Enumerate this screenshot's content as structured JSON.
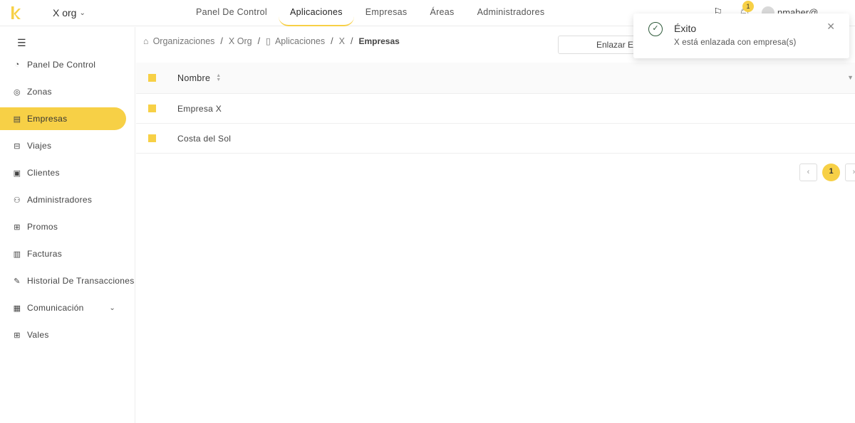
{
  "header": {
    "org_name": "X org",
    "nav": [
      "Panel De Control",
      "Aplicaciones",
      "Empresas",
      "Áreas",
      "Administradores"
    ],
    "active_nav": "Aplicaciones",
    "notification_count": "1",
    "username": "nmaher@"
  },
  "sidebar": {
    "items": [
      {
        "label": "Panel De Control",
        "icon": "pie-chart-icon"
      },
      {
        "label": "Zonas",
        "icon": "location-pin-icon"
      },
      {
        "label": "Empresas",
        "icon": "building-icon"
      },
      {
        "label": "Viajes",
        "icon": "car-icon"
      },
      {
        "label": "Clientes",
        "icon": "id-card-icon"
      },
      {
        "label": "Administradores",
        "icon": "users-icon"
      },
      {
        "label": "Promos",
        "icon": "gift-icon"
      },
      {
        "label": "Facturas",
        "icon": "invoice-icon"
      },
      {
        "label": "Historial De Transacciones",
        "icon": "edit-icon"
      },
      {
        "label": "Comunicación",
        "icon": "message-icon"
      },
      {
        "label": "Vales",
        "icon": "gift-icon"
      }
    ],
    "active_item": "Empresas"
  },
  "breadcrumb": {
    "items": [
      "Organizaciones",
      "X Org",
      "Aplicaciones",
      "X",
      "Empresas"
    ]
  },
  "actions": {
    "link_button": "Enlazar Empresas"
  },
  "table": {
    "column_header": "Nombre",
    "rows": [
      "Empresa X",
      "Costa del Sol"
    ]
  },
  "pagination": {
    "current_page": "1"
  },
  "toast": {
    "title": "Éxito",
    "message": "X está enlazada con empresa(s)"
  },
  "colors": {
    "accent": "#f7d046",
    "success": "#2e5a3a"
  }
}
